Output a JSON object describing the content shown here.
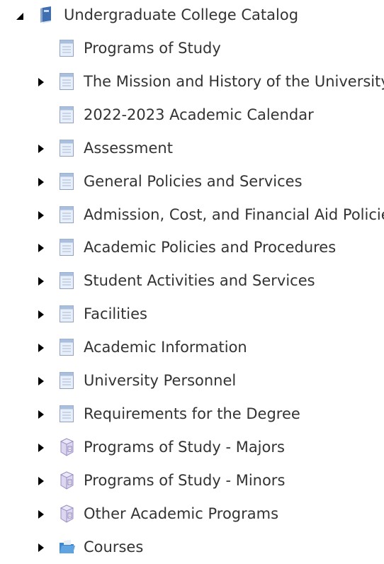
{
  "root": {
    "label": "Undergraduate College Catalog",
    "icon": "catalog-book-icon",
    "expanded": true
  },
  "children": [
    {
      "label": "Programs of Study",
      "icon": "page-icon",
      "has_children": false
    },
    {
      "label": "The Mission and History of the University of",
      "icon": "page-icon",
      "has_children": true
    },
    {
      "label": "2022-2023 Academic Calendar",
      "icon": "page-icon",
      "has_children": false
    },
    {
      "label": "Assessment",
      "icon": "page-icon",
      "has_children": true
    },
    {
      "label": "General Policies and Services",
      "icon": "page-icon",
      "has_children": true
    },
    {
      "label": "Admission, Cost, and Financial Aid Policies",
      "icon": "page-icon",
      "has_children": true
    },
    {
      "label": "Academic Policies and Procedures",
      "icon": "page-icon",
      "has_children": true
    },
    {
      "label": "Student Activities and Services",
      "icon": "page-icon",
      "has_children": true
    },
    {
      "label": "Facilities",
      "icon": "page-icon",
      "has_children": true
    },
    {
      "label": "Academic Information",
      "icon": "page-icon",
      "has_children": true
    },
    {
      "label": "University Personnel",
      "icon": "page-icon",
      "has_children": true
    },
    {
      "label": "Requirements for the Degree",
      "icon": "page-icon",
      "has_children": true
    },
    {
      "label": "Programs of Study - Majors",
      "icon": "program-cube-icon",
      "has_children": true
    },
    {
      "label": "Programs of Study - Minors",
      "icon": "program-cube-icon",
      "has_children": true
    },
    {
      "label": "Other Academic Programs",
      "icon": "program-cube-icon",
      "has_children": true
    },
    {
      "label": "Courses",
      "icon": "folder-icon",
      "has_children": true
    }
  ],
  "colors": {
    "text": "#333333",
    "toggle": "#000000",
    "page_fill": "#e9eff8",
    "page_stroke": "#8ea3c4",
    "cube_fill": "#dcd6ef",
    "folder_fill": "#5fa3e0",
    "book_fill": "#4a7fc0"
  }
}
